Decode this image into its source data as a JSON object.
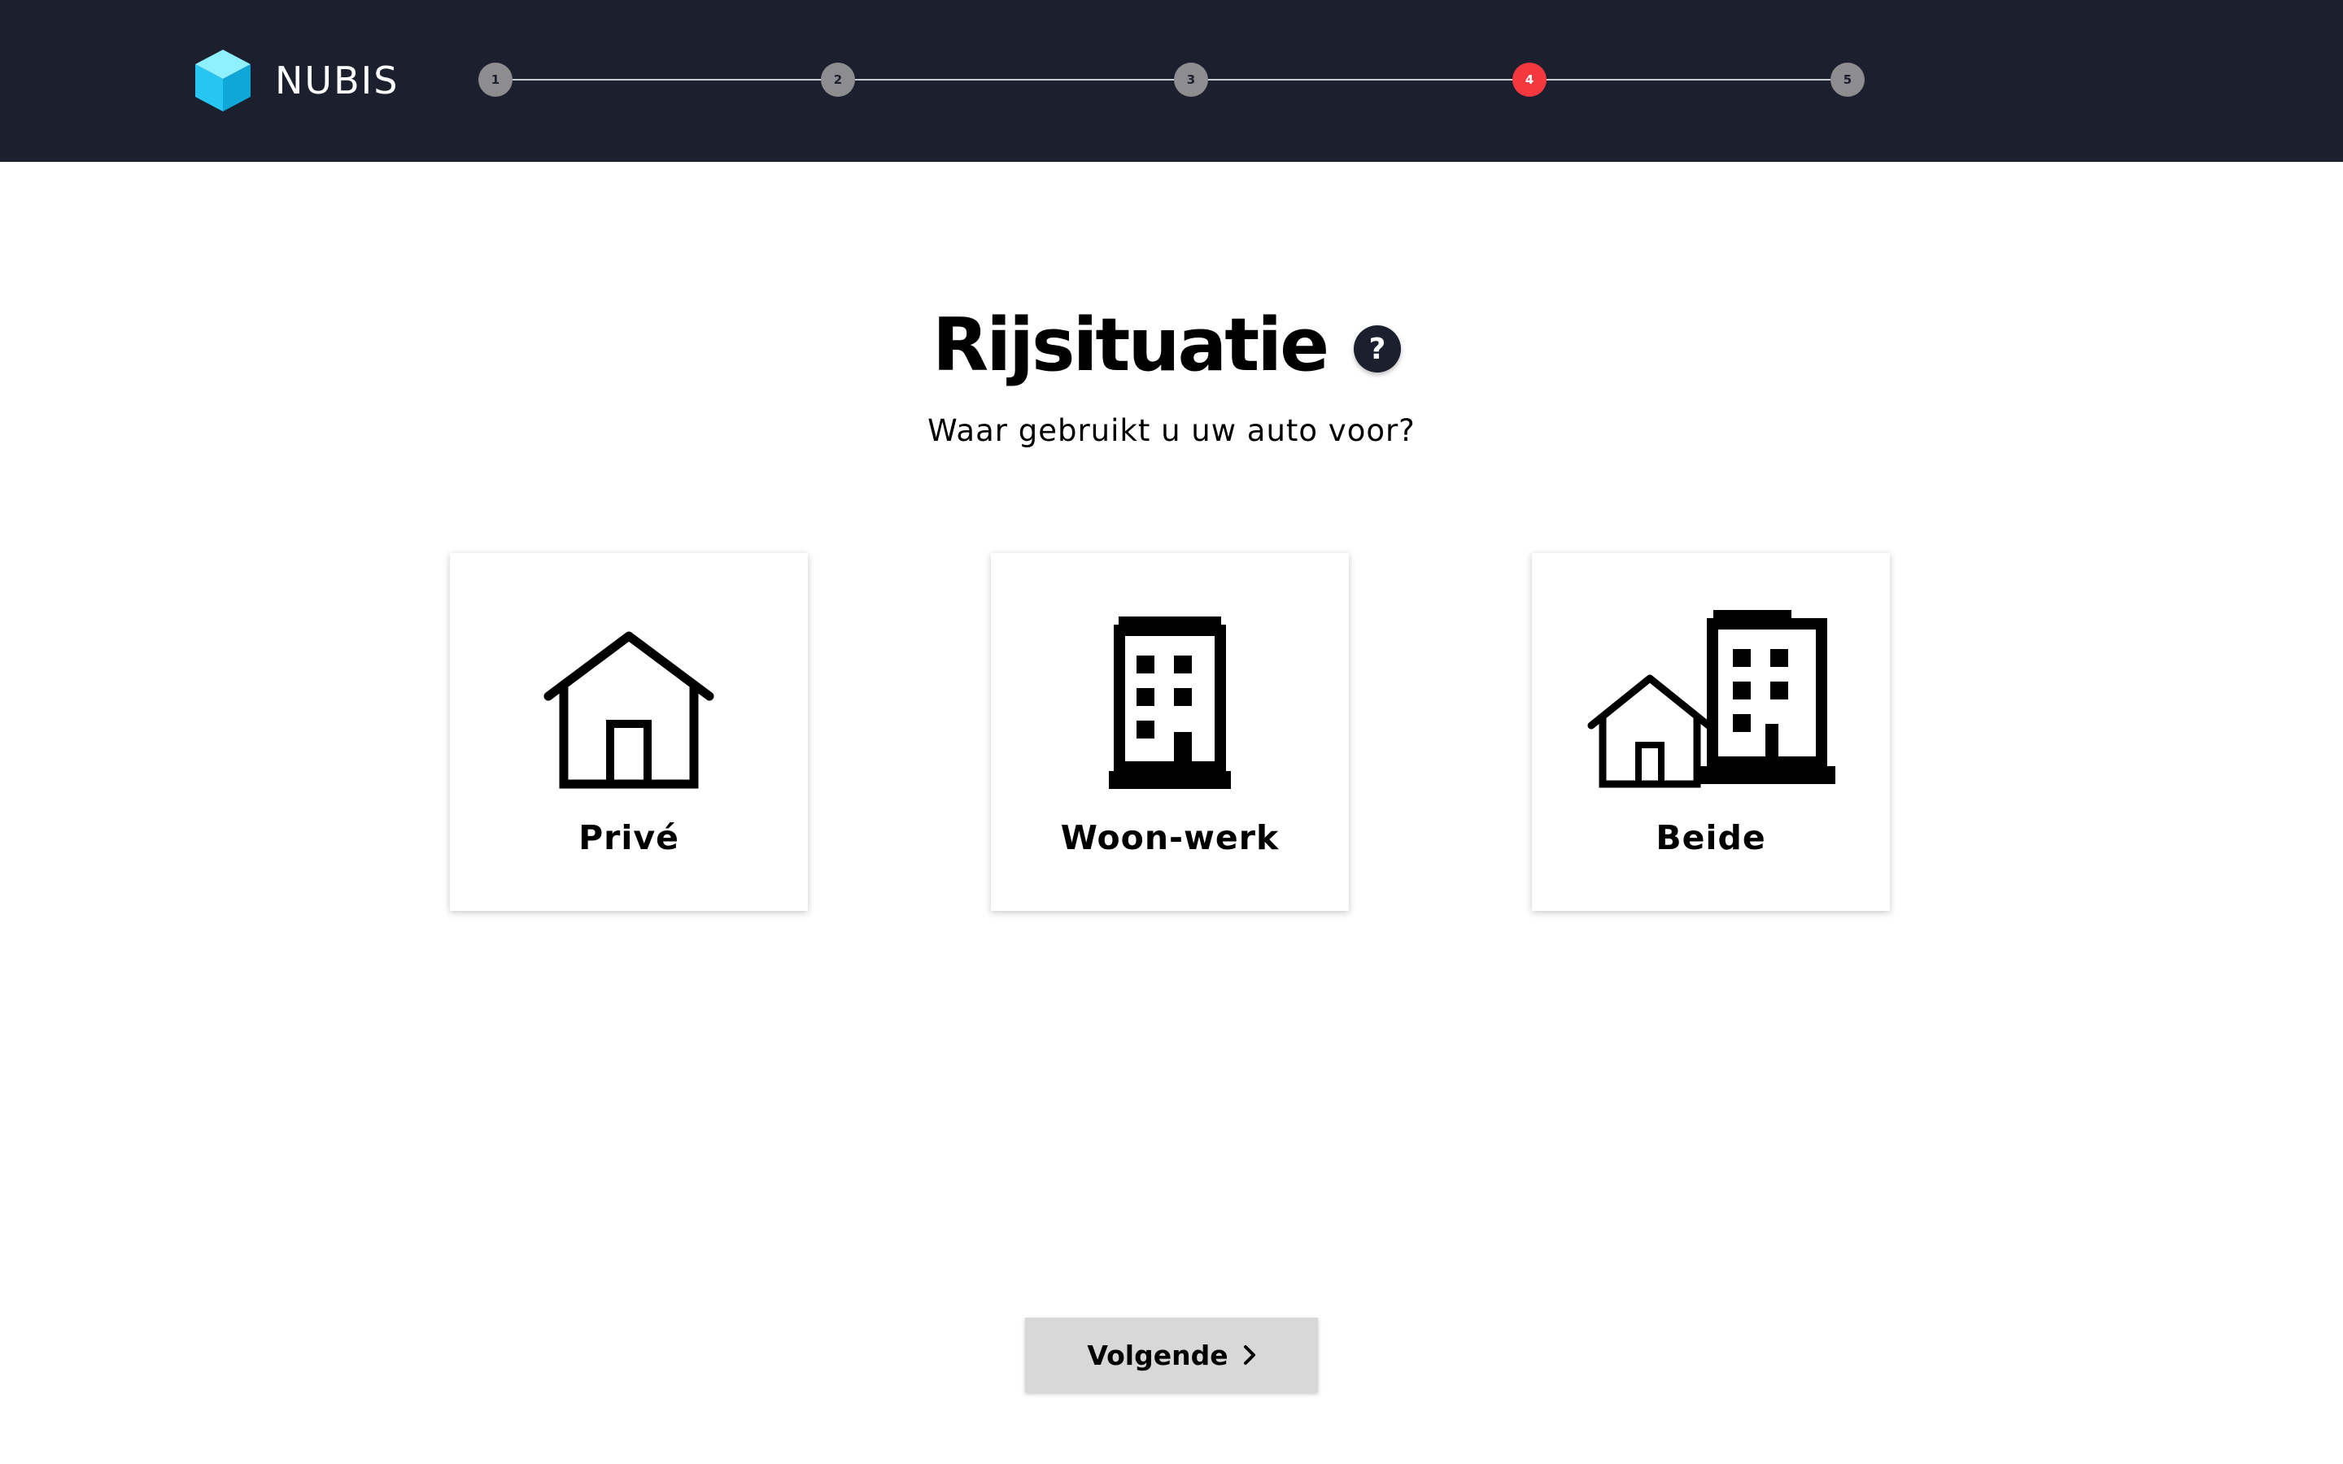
{
  "brand": {
    "name": "NUBIS",
    "logo_icon": "cube-icon",
    "colors": {
      "cube_light": "#7ee7ff",
      "cube_mid": "#2cc8f0",
      "cube_dark": "#11a9d6"
    }
  },
  "stepper": {
    "steps": [
      {
        "label": "1",
        "state": "inactive"
      },
      {
        "label": "2",
        "state": "inactive"
      },
      {
        "label": "3",
        "state": "inactive"
      },
      {
        "label": "4",
        "state": "active"
      },
      {
        "label": "5",
        "state": "inactive"
      }
    ],
    "current_step": 4,
    "active_color": "#f5383e",
    "inactive_color": "#8d8d8f"
  },
  "main": {
    "title": "Rijsituatie",
    "help_label": "?",
    "subtitle": "Waar gebruikt u uw auto voor?"
  },
  "options": [
    {
      "label": "Privé",
      "icon": "house-icon"
    },
    {
      "label": "Woon-werk",
      "icon": "office-building-icon"
    },
    {
      "label": "Beide",
      "icon": "house-and-building-icon"
    }
  ],
  "footer": {
    "next_label": "Volgende",
    "next_icon": "chevron-right-icon"
  },
  "colors": {
    "header_bg": "#1b1f2e",
    "page_bg": "#ffffff",
    "button_bg": "#d8d8d8"
  }
}
